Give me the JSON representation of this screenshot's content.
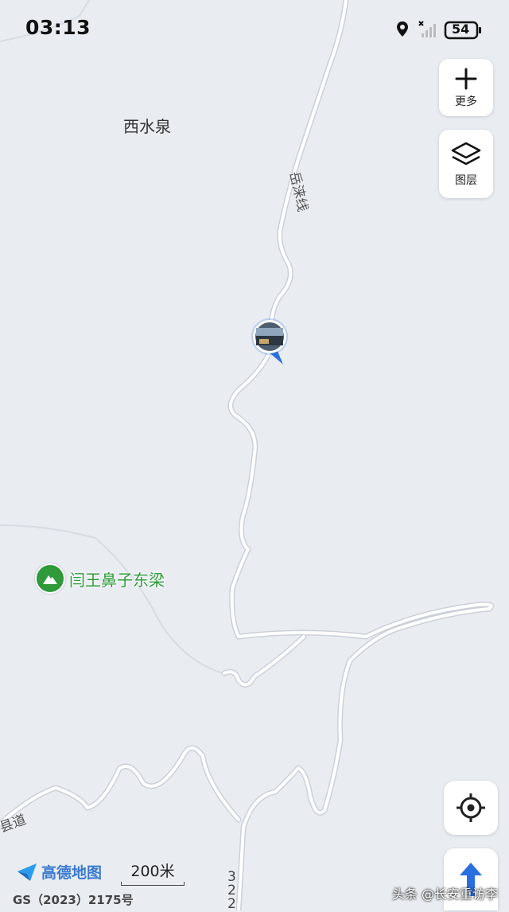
{
  "status_bar": {
    "time": "03:13",
    "battery": "54",
    "icons": [
      "location-icon",
      "signal-icon",
      "battery-icon"
    ]
  },
  "controls": {
    "more_label": "更多",
    "layers_label": "图层"
  },
  "map": {
    "place_label": "西水泉",
    "road_label": "岳涞线",
    "road_label_county": "县道",
    "road_number_vertical": "322",
    "poi_label": "闫王鼻子东梁",
    "colors": {
      "background": "#e9edf2",
      "road": "#ffffff",
      "road_edge": "#c8ced6",
      "poi": "#2e9a3a",
      "accent": "#2a6fe0"
    }
  },
  "footer": {
    "logo_text": "高德地图",
    "scale_text": "200米",
    "copyright": "GS（2023）2175号",
    "watermark": "头条 @长安重访李"
  }
}
